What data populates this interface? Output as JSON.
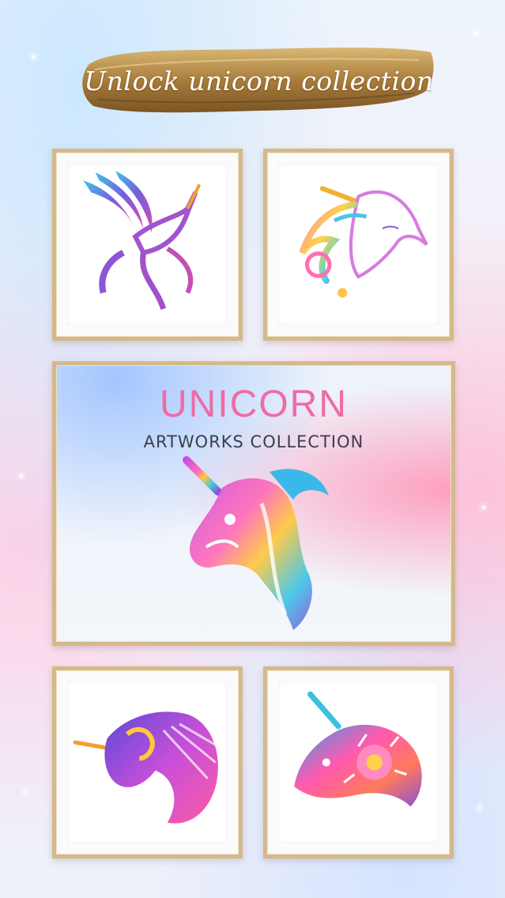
{
  "banner": {
    "title": "Unlock unicorn collection"
  },
  "feature": {
    "title": "UNICORN",
    "subtitle": "ARTWORKS COLLECTION"
  },
  "artworks": [
    {
      "icon": "flying-pegasus-icon"
    },
    {
      "icon": "unicorn-head-swirl-icon"
    },
    {
      "icon": "glitter-unicorn-head-icon"
    },
    {
      "icon": "winged-unicorn-icon"
    },
    {
      "icon": "mandala-unicorn-icon"
    }
  ],
  "colors": {
    "frame_gold": "#d4b98a",
    "title_pink": "#f06aa4",
    "banner_gold": "#b8914a"
  }
}
